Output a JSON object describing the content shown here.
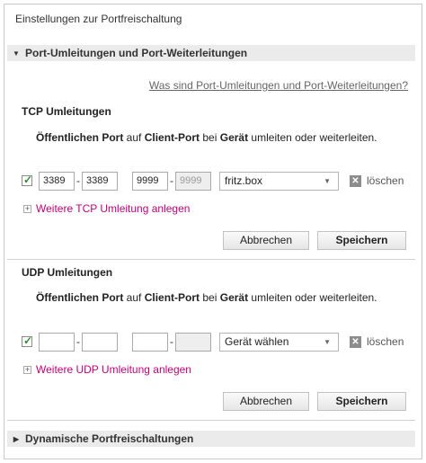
{
  "page": {
    "title": "Einstellungen zur Portfreischaltung"
  },
  "section_port": {
    "header": "Port-Umleitungen und Port-Weiterleitungen",
    "help_link": "Was sind Port-Umleitungen und Port-Weiterleitungen?"
  },
  "tcp": {
    "title": "TCP Umleitungen",
    "desc": {
      "part1": "Öffentlichen Port",
      "part2": " auf ",
      "part3": "Client-Port",
      "part4": " bei ",
      "part5": "Gerät",
      "part6": " umleiten oder weiterleiten."
    },
    "rule": {
      "checked": true,
      "public_from": "3389",
      "public_to": "3389",
      "client_from": "9999",
      "client_to": "9999",
      "device": "fritz.box",
      "delete_label": "löschen"
    },
    "add_label": "Weitere TCP Umleitung anlegen",
    "cancel_label": "Abbrechen",
    "save_label": "Speichern"
  },
  "udp": {
    "title": "UDP Umleitungen",
    "desc": {
      "part1": "Öffentlichen Port",
      "part2": " auf ",
      "part3": "Client-Port",
      "part4": " bei ",
      "part5": "Gerät",
      "part6": " umleiten oder weiterleiten."
    },
    "rule": {
      "checked": true,
      "public_from": "",
      "public_to": "",
      "client_from": "",
      "client_to": "",
      "device": "Gerät wählen",
      "delete_label": "löschen"
    },
    "add_label": "Weitere UDP Umleitung anlegen",
    "cancel_label": "Abbrechen",
    "save_label": "Speichern"
  },
  "section_dynamic": {
    "header": "Dynamische Portfreischaltungen"
  },
  "icons": {
    "expanded": "triangle-down-icon",
    "collapsed": "triangle-right-icon",
    "check": "checkmark-icon",
    "delete": "delete-x-icon",
    "add": "plus-icon",
    "dropdown": "dropdown-caret-icon"
  },
  "colors": {
    "link_accent": "#c0007a",
    "header_bg": "#ebebeb",
    "check_green": "#2e8b2e"
  }
}
